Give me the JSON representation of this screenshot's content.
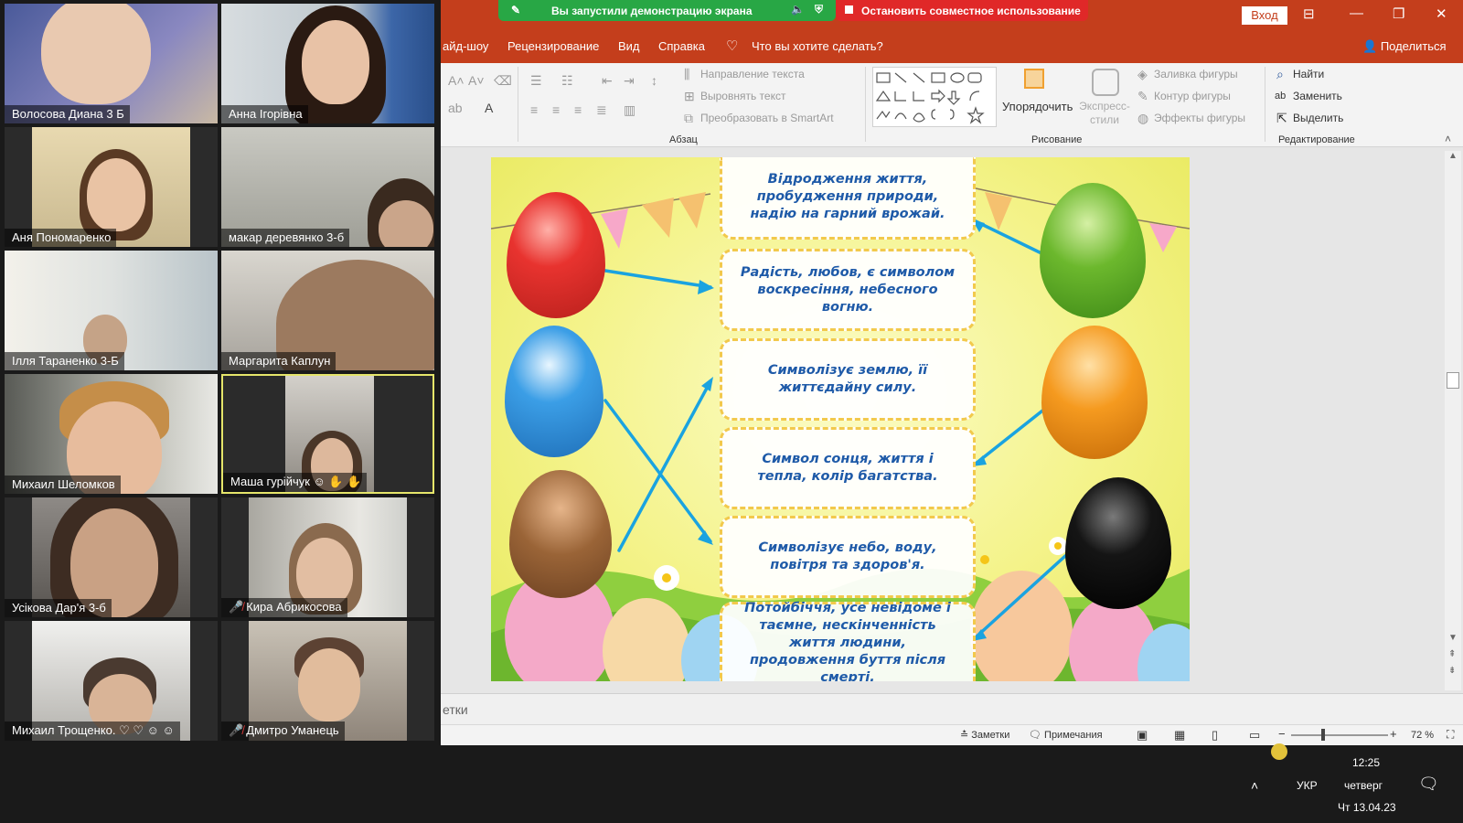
{
  "screen_share": {
    "status_text": "Вы запустили демонстрацию экрана",
    "stop_label": "Остановить совместное использование"
  },
  "window": {
    "sign_in": "Вход"
  },
  "ribbon_tabs": [
    "айд-шоу",
    "Рецензирование",
    "Вид",
    "Справка"
  ],
  "tell_me": "Что вы хотите сделать?",
  "share_label": "Поделиться",
  "ribbon": {
    "paragraph": {
      "text_direction": "Направление текста",
      "align_text": "Выровнять текст",
      "smartart": "Преобразовать в SmartArt",
      "label": "Абзац"
    },
    "drawing": {
      "arrange": "Упорядочить",
      "quick_styles": "Экспресс-стили",
      "shape_fill": "Заливка фигуры",
      "shape_outline": "Контур фигуры",
      "shape_effects": "Эффекты фигуры",
      "label": "Рисование"
    },
    "editing": {
      "find": "Найти",
      "replace": "Заменить",
      "select": "Выделить",
      "label": "Редактирование"
    }
  },
  "slide": {
    "cards": [
      "Відродження життя, пробудження природи, надію на гарний врожай.",
      "Радість, любов, є символом воскресіння, небесного вогню.",
      "Символізує землю, її життєдайну силу.",
      "Символ сонця, життя і тепла, колір багатства.",
      "Символізує небо, воду, повітря та здоров'я.",
      "Потойбіччя, усе невідоме і таємне, нескінченність життя людини, продовження буття після смерті."
    ],
    "egg_colors": {
      "red": "#e8332f",
      "blue": "#3b9ee6",
      "brown": "#9a6437",
      "green": "#6cb82d",
      "orange": "#f59a1f",
      "black": "#151515"
    }
  },
  "notes_placeholder": "етки",
  "status": {
    "notes": "Заметки",
    "comments": "Примечания",
    "zoom": "72 %"
  },
  "taskbar": {
    "lang": "УКР",
    "time": "12:25",
    "day": "четверг",
    "date": "Чт 13.04.23"
  },
  "participants": [
    {
      "name": "Волосова Диана 3 Б",
      "muted": false
    },
    {
      "name": "Анна Ігорівна",
      "muted": false
    },
    {
      "name": "Аня Пономаренко",
      "muted": false
    },
    {
      "name": "макар  деревянко 3-б",
      "muted": false
    },
    {
      "name": "Ілля Тараненко 3-Б",
      "muted": false
    },
    {
      "name": "Маргарита Каплун",
      "muted": false
    },
    {
      "name": "Михаил Шеломков",
      "muted": false
    },
    {
      "name": "Маша  гурійчук",
      "muted": false
    },
    {
      "name": "Усікова Дар'я 3-б",
      "muted": false
    },
    {
      "name": "Кира Абрикосова",
      "muted": true
    },
    {
      "name": "Михаил Трощенко.",
      "muted": false
    },
    {
      "name": "Дмитро Уманець",
      "muted": true
    }
  ]
}
